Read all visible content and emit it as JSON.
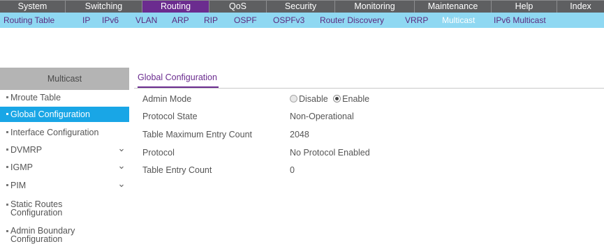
{
  "top_menu": {
    "tabs": [
      {
        "label": "System"
      },
      {
        "label": "Switching"
      },
      {
        "label": "Routing",
        "active": true
      },
      {
        "label": "QoS"
      },
      {
        "label": "Security"
      },
      {
        "label": "Monitoring"
      },
      {
        "label": "Maintenance"
      },
      {
        "label": "Help"
      },
      {
        "label": "Index"
      }
    ],
    "active_color": "#6b2c8f"
  },
  "sub_menu": {
    "items": [
      {
        "label": "Routing Table"
      },
      {
        "label": "IP"
      },
      {
        "label": "IPv6"
      },
      {
        "label": "VLAN"
      },
      {
        "label": "ARP"
      },
      {
        "label": "RIP"
      },
      {
        "label": "OSPF"
      },
      {
        "label": "OSPFv3"
      },
      {
        "label": "Router Discovery"
      },
      {
        "label": "VRRP"
      },
      {
        "label": "Multicast",
        "active": true
      },
      {
        "label": "IPv6 Multicast"
      }
    ],
    "background": "#8fd8f2"
  },
  "sidebar": {
    "title": "Multicast",
    "items": [
      {
        "label": "Mroute Table"
      },
      {
        "label": "Global Configuration",
        "active": true
      },
      {
        "label": "Interface Configuration"
      },
      {
        "label": "DVMRP",
        "expandable": true
      },
      {
        "label": "IGMP",
        "expandable": true
      },
      {
        "label": "PIM",
        "expandable": true
      },
      {
        "label": "Static Routes Configuration"
      },
      {
        "label": "Admin Boundary Configuration"
      }
    ],
    "active_color": "#19a6e6"
  },
  "main": {
    "tab_title": "Global Configuration",
    "fields": {
      "admin_mode": {
        "label": "Admin Mode",
        "options": [
          "Disable",
          "Enable"
        ],
        "selected": "Enable"
      },
      "protocol_state": {
        "label": "Protocol State",
        "value": "Non-Operational"
      },
      "table_max_entry_count": {
        "label": "Table Maximum Entry Count",
        "value": "2048"
      },
      "protocol": {
        "label": "Protocol",
        "value": "No Protocol Enabled"
      },
      "table_entry_count": {
        "label": "Table Entry Count",
        "value": "0"
      }
    }
  }
}
